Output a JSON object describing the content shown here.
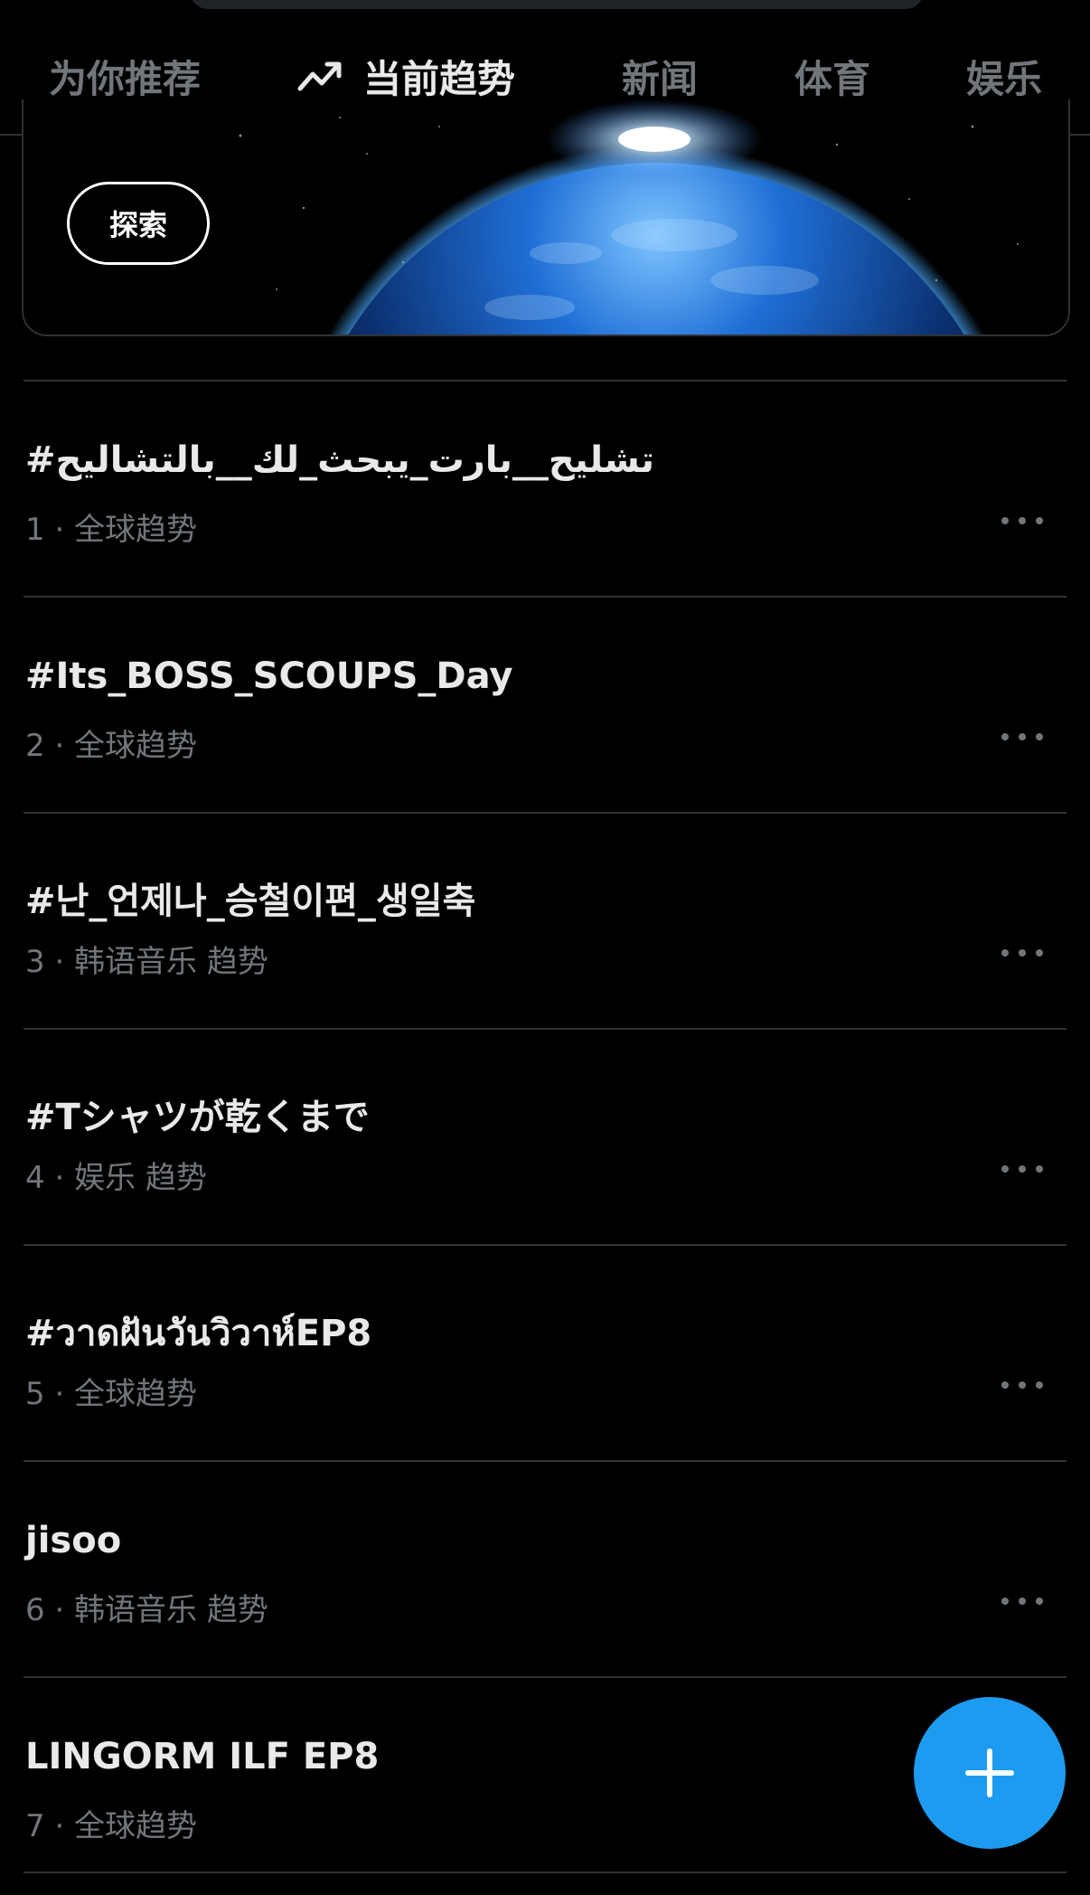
{
  "tabs": [
    {
      "label": "为你推荐"
    },
    {
      "label": "当前趋势",
      "icon": "trending-icon"
    },
    {
      "label": "新闻"
    },
    {
      "label": "体育"
    },
    {
      "label": "娱乐"
    }
  ],
  "active_tab": "当前趋势",
  "banner": {
    "explore_label": "探索"
  },
  "trends": [
    {
      "title": "#تشليح__بارت_يبحث_لك__بالتشاليح",
      "meta": "1 · 全球趋势"
    },
    {
      "title": "#Its_BOSS_SCOUPS_Day",
      "meta": "2 · 全球趋势"
    },
    {
      "title": "#난_언제나_승철이편_생일축",
      "meta": "3 · 韩语音乐 趋势"
    },
    {
      "title": "#Tシャツが乾くまで",
      "meta": "4 · 娱乐 趋势"
    },
    {
      "title": "#วาดฝันวันวิวาห์EP8",
      "meta": "5 · 全球趋势"
    },
    {
      "title": "jisoo",
      "meta": "6 · 韩语音乐 趋势"
    },
    {
      "title": "LINGORM ILF EP8",
      "meta": "7 · 全球趋势"
    }
  ],
  "colors": {
    "background": "#000000",
    "primary_text": "#e7e9ea",
    "secondary_text": "#71767b",
    "divider": "#2f3336",
    "accent": "#1d9bf0"
  }
}
